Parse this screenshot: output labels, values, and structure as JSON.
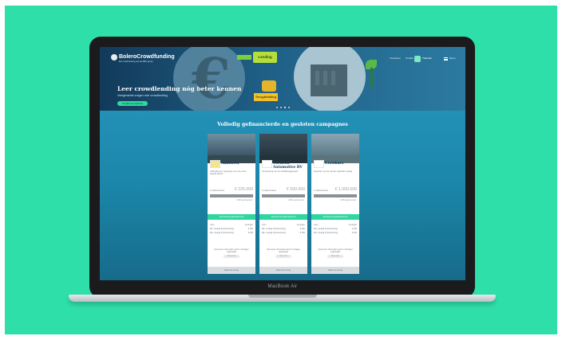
{
  "device": {
    "label": "MacBook Air"
  },
  "colors": {
    "background": "#2fdfa9",
    "accent": "#2fd79e",
    "primary": "#0f4160"
  },
  "header": {
    "logo": "BoleroCrowdfunding",
    "logo_sub": "Een onderneming van de KBC-groep",
    "nav": [
      "Investeren",
      "Ontdek",
      "Themati"
    ],
    "menu": "Menu"
  },
  "hero": {
    "title": "Leer crowdlending nóg beter kennen",
    "subtitle": "Veelgestelde vragen over crowdlending",
    "button": "Ontdek het webinar",
    "box_top": "Lending",
    "box_bottom": "Terugbetaling"
  },
  "section_title": "Volledig gefinancierde en gesloten campagnes",
  "campaigns": [
    {
      "title": "Ambiorix",
      "desc": "Uitbreiding en opgraving voor een extra tweede kliniek",
      "amount_label": "Je Welverrekend",
      "amount": "€ 225.000",
      "progress": 1.0,
      "progress_label": "100% gefinancierd",
      "status": "Succesvol gefinancierd",
      "row1_label": "Type",
      "row1_value": "Leningen",
      "row2_label": "Min. bedrag bij financiering",
      "row2_value": "€ 250",
      "row3_label": "Min. bedrag bij financiering",
      "row3_value": "€ 250",
      "foot": "Succesvol, dit krediet werd in 12 dagen opgehaald",
      "pill": "Meer info",
      "button": "Naar de lening"
    },
    {
      "title": "Cornelis Automotive BV",
      "desc": "Vernieuwing van het bedrijfswagenpark",
      "amount_label": "Je Welverrekend",
      "amount": "€ 500.000",
      "progress": 1.0,
      "progress_label": "100% gefinancierd",
      "status": "Succesvol gefinancierd",
      "row1_label": "Type",
      "row1_value": "Leningen",
      "row2_label": "Min. bedrag bij financiering",
      "row2_value": "€ 250",
      "row3_label": "Min. bedrag bij financiering",
      "row3_value": "€ 250",
      "foot": "Succesvol, dit krediet werd in 9 dagen opgehaald",
      "pill": "Meer info",
      "button": "Naar de lening"
    },
    {
      "title": "Crowbars",
      "desc": "Expansie van de nieuwe logistieke opslag",
      "amount_label": "Je Welverrekend",
      "amount": "€ 1.000.000",
      "progress": 1.0,
      "progress_label": "100% gefinancierd",
      "status": "Succesvol gefinancierd",
      "row1_label": "Type",
      "row1_value": "Leningen",
      "row2_label": "Min. bedrag bij financiering",
      "row2_value": "€ 250",
      "row3_label": "Min. bedrag bij financiering",
      "row3_value": "€ 250",
      "foot": "Succesvol, dit krediet werd in 14 dagen opgehaald",
      "pill": "Meer info",
      "button": "Naar de lening"
    }
  ]
}
